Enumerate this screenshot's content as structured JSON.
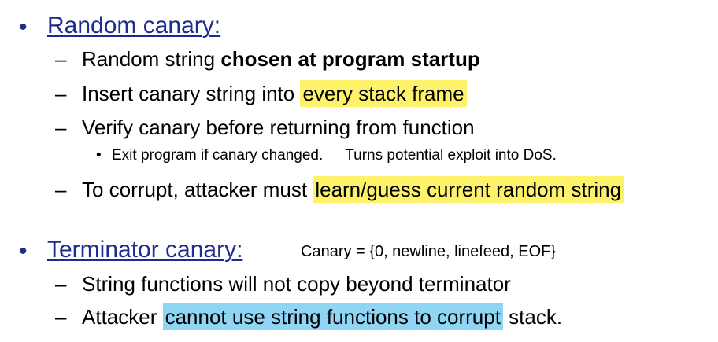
{
  "section1": {
    "bullet": "•",
    "heading": "Random canary:",
    "items": [
      {
        "dash": "–",
        "plain": "Random string ",
        "bold": "chosen at program startup"
      },
      {
        "dash": "–",
        "plain": "Insert canary string into ",
        "highlight": "every stack frame"
      },
      {
        "dash": "–",
        "plain": "Verify canary before returning from function"
      },
      {
        "dash": "–",
        "plain": "To corrupt, attacker must ",
        "highlight": "learn/guess current random string"
      }
    ],
    "subitem": {
      "bullet": "•",
      "text1": "Exit program if canary changed.",
      "text2": "Turns potential exploit into DoS."
    }
  },
  "section2": {
    "bullet": "•",
    "heading": "Terminator canary:",
    "note": "Canary =  {0, newline, linefeed, EOF}",
    "items": [
      {
        "dash": "–",
        "plain": "String functions will not copy beyond terminator"
      },
      {
        "dash": "–",
        "plain": "Attacker ",
        "highlight": "cannot use string functions to corrupt",
        "tail": " stack."
      }
    ]
  },
  "colors": {
    "heading": "#1f2c8f",
    "highlight_yellow": "#fff26b",
    "highlight_blue": "#8fd6f5"
  }
}
